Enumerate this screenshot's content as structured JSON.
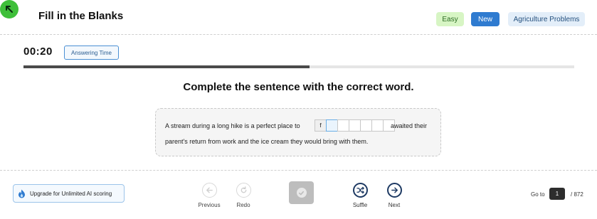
{
  "header": {
    "back_icon": "arrow-up-left-icon",
    "title": "Fill in the Blanks",
    "tags": {
      "difficulty": "Easy",
      "status": "New",
      "category": "Agriculture Problems"
    }
  },
  "timer": {
    "time": "00:20",
    "label": "Answering Time",
    "progress_fraction": 0.52
  },
  "question": {
    "prompt": "Complete the sentence with the correct word.",
    "sentence_before": "A stream during a long hike is a perfect place to",
    "sentence_after": "awaited their",
    "sentence_line2": "parent's return from work and the ice cream they would bring with them.",
    "answer_letters": [
      "f",
      "",
      "",
      "",
      "",
      "",
      ""
    ]
  },
  "footer": {
    "upgrade_label": "Upgrade for Unlimited AI scoring",
    "controls": {
      "previous": "Previous",
      "redo": "Redo",
      "shuffle": "Suffle",
      "next": "Next"
    },
    "goto": {
      "label": "Go to",
      "page": "1",
      "total": "/ 872"
    }
  },
  "colors": {
    "accent_green": "#3fbf3a",
    "primary_blue": "#2f7bd0",
    "dark_navy": "#1e3a63"
  }
}
